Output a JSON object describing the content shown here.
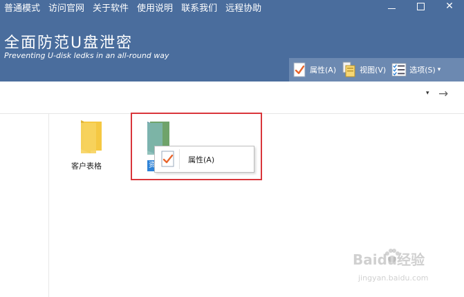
{
  "menu": {
    "items": [
      "普通模式",
      "访问官网",
      "关于软件",
      "使用说明",
      "联系我们",
      "远程协助"
    ]
  },
  "window": {
    "close_glyph": "✕"
  },
  "app": {
    "title": "全面防范U盘泄密",
    "subtitle": "Preventing U-disk ledks in an all-round way"
  },
  "toolbar": {
    "properties_label": "属性(A)",
    "view_label": "视图(V)",
    "options_label": "选项(S)",
    "options_dropdown_glyph": "▾"
  },
  "addressbar": {
    "dropdown_glyph": "▾",
    "go_glyph": "→"
  },
  "files": {
    "folder1_label": "客户表格",
    "folder2_selected_label": "资"
  },
  "context_menu": {
    "properties_label": "属性(A)"
  },
  "watermark": {
    "brand": "Baidu经验",
    "url": "jingyan.baidu.com"
  },
  "colors": {
    "header_bg": "#4a6d9d",
    "toolbar_bg": "#6c89b1",
    "highlight_border": "#d9353a",
    "selection_blue": "#2d82d7",
    "folder_yellow": "#f5c842",
    "folder_green": "#6fa36a",
    "check_orange": "#e8652c"
  },
  "icons": {
    "properties": "check-document-icon",
    "view": "view-pages-icon",
    "options": "checklist-icon"
  }
}
